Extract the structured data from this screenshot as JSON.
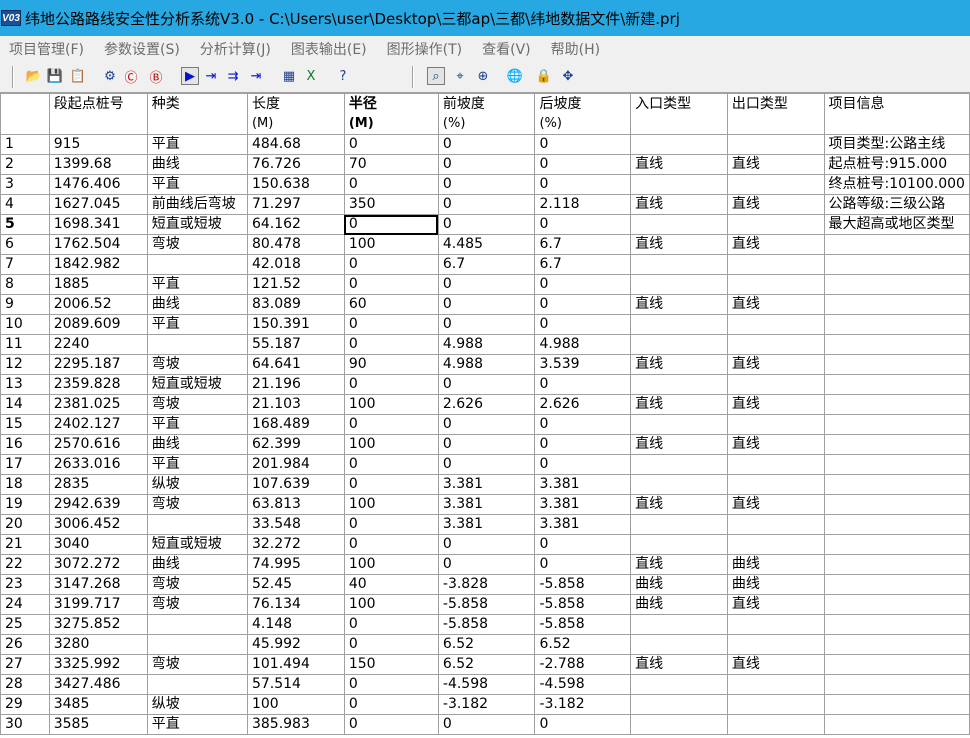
{
  "window": {
    "title": "纬地公路路线安全性分析系统V3.0 - C:\\Users\\user\\Desktop\\三都ap\\三都\\纬地数据文件\\新建.prj",
    "icon_text": "V03"
  },
  "menu": [
    "项目管理(F)",
    "参数设置(S)",
    "分析计算(J)",
    "图表输出(E)",
    "图形操作(T)",
    "查看(V)",
    "帮助(H)"
  ],
  "toolbar": [
    {
      "icon": "open-folder-icon",
      "glyph": "📂"
    },
    {
      "icon": "save-icon",
      "glyph": "💾"
    },
    {
      "icon": "copy-icon",
      "glyph": "📋"
    },
    {
      "icon": "settings-icon",
      "glyph": "⚙"
    },
    {
      "icon": "c-circle-icon",
      "glyph": "Ⓒ"
    },
    {
      "icon": "b-circle-icon",
      "glyph": "Ⓑ"
    },
    {
      "icon": "play-icon",
      "glyph": "▶"
    },
    {
      "icon": "step-icon",
      "glyph": "⇥"
    },
    {
      "icon": "step-two-icon",
      "glyph": "⇉"
    },
    {
      "icon": "step-end-icon",
      "glyph": "⇥"
    },
    {
      "icon": "grid-icon",
      "glyph": "▦"
    },
    {
      "icon": "excel-icon",
      "glyph": "X"
    },
    {
      "icon": "help-icon",
      "glyph": "?"
    },
    {
      "icon": "zoom-window-icon",
      "glyph": "⌕"
    },
    {
      "icon": "zoom-realtime-icon",
      "glyph": "⌖"
    },
    {
      "icon": "zoom-extent-icon",
      "glyph": "⊕"
    },
    {
      "icon": "globe-icon",
      "glyph": "🌐"
    },
    {
      "icon": "lock-icon",
      "glyph": "🔒"
    },
    {
      "icon": "pan-icon",
      "glyph": "✥"
    }
  ],
  "columns": [
    {
      "label": "段起点桩号",
      "unit": "",
      "bold": false
    },
    {
      "label": "种类",
      "unit": "",
      "bold": false
    },
    {
      "label": "长度",
      "unit": "(M)",
      "bold": false
    },
    {
      "label": "半径",
      "unit": "(M)",
      "bold": true
    },
    {
      "label": "前坡度",
      "unit": "(%)",
      "bold": false
    },
    {
      "label": "后坡度",
      "unit": "(%)",
      "bold": false
    },
    {
      "label": "入口类型",
      "unit": "",
      "bold": false
    },
    {
      "label": "出口类型",
      "unit": "",
      "bold": false
    },
    {
      "label": "项目信息",
      "unit": "",
      "bold": false
    }
  ],
  "rows": [
    [
      "1",
      "915",
      "平直",
      "484.68",
      "0",
      "0",
      "0",
      "",
      "",
      "项目类型:公路主线"
    ],
    [
      "2",
      "1399.68",
      "曲线",
      "76.726",
      "70",
      "0",
      "0",
      "直线",
      "直线",
      "起点桩号:915.000"
    ],
    [
      "3",
      "1476.406",
      "平直",
      "150.638",
      "0",
      "0",
      "0",
      "",
      "",
      "终点桩号:10100.000"
    ],
    [
      "4",
      "1627.045",
      "前曲线后弯坡",
      "71.297",
      "350",
      "0",
      "2.118",
      "直线",
      "直线",
      "公路等级:三级公路"
    ],
    [
      "5",
      "1698.341",
      "短直或短坡",
      "64.162",
      "0",
      "0",
      "0",
      "",
      "",
      "最大超高或地区类型"
    ],
    [
      "6",
      "1762.504",
      "弯坡",
      "80.478",
      "100",
      "4.485",
      "6.7",
      "直线",
      "直线",
      ""
    ],
    [
      "7",
      "1842.982",
      "",
      "42.018",
      "0",
      "6.7",
      "6.7",
      "",
      "",
      ""
    ],
    [
      "8",
      "1885",
      "平直",
      "121.52",
      "0",
      "0",
      "0",
      "",
      "",
      ""
    ],
    [
      "9",
      "2006.52",
      "曲线",
      "83.089",
      "60",
      "0",
      "0",
      "直线",
      "直线",
      ""
    ],
    [
      "10",
      "2089.609",
      "平直",
      "150.391",
      "0",
      "0",
      "0",
      "",
      "",
      ""
    ],
    [
      "11",
      "2240",
      "",
      "55.187",
      "0",
      "4.988",
      "4.988",
      "",
      "",
      ""
    ],
    [
      "12",
      "2295.187",
      "弯坡",
      "64.641",
      "90",
      "4.988",
      "3.539",
      "直线",
      "直线",
      ""
    ],
    [
      "13",
      "2359.828",
      "短直或短坡",
      "21.196",
      "0",
      "0",
      "0",
      "",
      "",
      ""
    ],
    [
      "14",
      "2381.025",
      "弯坡",
      "21.103",
      "100",
      "2.626",
      "2.626",
      "直线",
      "直线",
      ""
    ],
    [
      "15",
      "2402.127",
      "平直",
      "168.489",
      "0",
      "0",
      "0",
      "",
      "",
      ""
    ],
    [
      "16",
      "2570.616",
      "曲线",
      "62.399",
      "100",
      "0",
      "0",
      "直线",
      "直线",
      ""
    ],
    [
      "17",
      "2633.016",
      "平直",
      "201.984",
      "0",
      "0",
      "0",
      "",
      "",
      ""
    ],
    [
      "18",
      "2835",
      "纵坡",
      "107.639",
      "0",
      "3.381",
      "3.381",
      "",
      "",
      ""
    ],
    [
      "19",
      "2942.639",
      "弯坡",
      "63.813",
      "100",
      "3.381",
      "3.381",
      "直线",
      "直线",
      ""
    ],
    [
      "20",
      "3006.452",
      "",
      "33.548",
      "0",
      "3.381",
      "3.381",
      "",
      "",
      ""
    ],
    [
      "21",
      "3040",
      "短直或短坡",
      "32.272",
      "0",
      "0",
      "0",
      "",
      "",
      ""
    ],
    [
      "22",
      "3072.272",
      "曲线",
      "74.995",
      "100",
      "0",
      "0",
      "直线",
      "曲线",
      ""
    ],
    [
      "23",
      "3147.268",
      "弯坡",
      "52.45",
      "40",
      "-3.828",
      "-5.858",
      "曲线",
      "曲线",
      ""
    ],
    [
      "24",
      "3199.717",
      "弯坡",
      "76.134",
      "100",
      "-5.858",
      "-5.858",
      "曲线",
      "直线",
      ""
    ],
    [
      "25",
      "3275.852",
      "",
      "4.148",
      "0",
      "-5.858",
      "-5.858",
      "",
      "",
      ""
    ],
    [
      "26",
      "3280",
      "",
      "45.992",
      "0",
      "6.52",
      "6.52",
      "",
      "",
      ""
    ],
    [
      "27",
      "3325.992",
      "弯坡",
      "101.494",
      "150",
      "6.52",
      "-2.788",
      "直线",
      "直线",
      ""
    ],
    [
      "28",
      "3427.486",
      "",
      "57.514",
      "0",
      "-4.598",
      "-4.598",
      "",
      "",
      ""
    ],
    [
      "29",
      "3485",
      "纵坡",
      "100",
      "0",
      "-3.182",
      "-3.182",
      "",
      "",
      ""
    ],
    [
      "30",
      "3585",
      "平直",
      "385.983",
      "0",
      "0",
      "0",
      "",
      "",
      ""
    ]
  ],
  "selected_cell": {
    "row": 5,
    "col": 4
  }
}
